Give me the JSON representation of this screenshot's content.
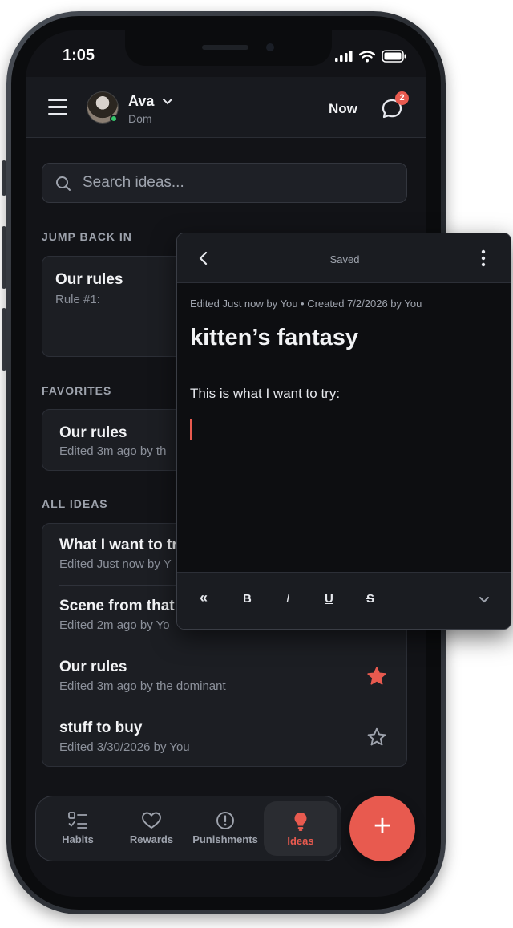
{
  "status": {
    "time": "1:05"
  },
  "header": {
    "user_name": "Ava",
    "user_role": "Dom",
    "now_label": "Now",
    "notification_count": "2"
  },
  "search": {
    "placeholder": "Search ideas..."
  },
  "jump_back": {
    "label": "JUMP BACK IN",
    "card": {
      "title": "Our rules",
      "subtitle": "Rule #1:"
    }
  },
  "favorites": {
    "label": "FAVORITES",
    "card": {
      "title": "Our rules",
      "subtitle": "Edited 3m ago by th"
    }
  },
  "all_ideas": {
    "label": "ALL IDEAS",
    "items": [
      {
        "title": "What I want to tr",
        "subtitle": "Edited Just now by Y",
        "favorite": false
      },
      {
        "title": "Scene from that",
        "subtitle": "Edited 2m ago by Yo",
        "favorite": false
      },
      {
        "title": "Our rules",
        "subtitle": "Edited 3m ago by the dominant",
        "favorite": true
      },
      {
        "title": "stuff to buy",
        "subtitle": "Edited 3/30/2026 by You",
        "favorite": false
      }
    ]
  },
  "tabs": [
    {
      "label": "Habits",
      "icon": "checklist-icon",
      "active": false
    },
    {
      "label": "Rewards",
      "icon": "heart-icon",
      "active": false
    },
    {
      "label": "Punishments",
      "icon": "alert-circle-icon",
      "active": false
    },
    {
      "label": "Ideas",
      "icon": "lightbulb-icon",
      "active": true
    }
  ],
  "fab": {
    "label": "+"
  },
  "editor": {
    "status": "Saved",
    "meta": "Edited Just now by You • Created 7/2/2026 by You",
    "title": "kitten’s fantasy",
    "body": "This is what I want to try:",
    "toolbar": {
      "outdent": "«",
      "bold": "B",
      "italic": "I",
      "underline": "U",
      "strike": "S"
    }
  },
  "colors": {
    "accent": "#e85a4f",
    "background": "#121317",
    "card": "#1c1e23",
    "online": "#35c46a"
  }
}
